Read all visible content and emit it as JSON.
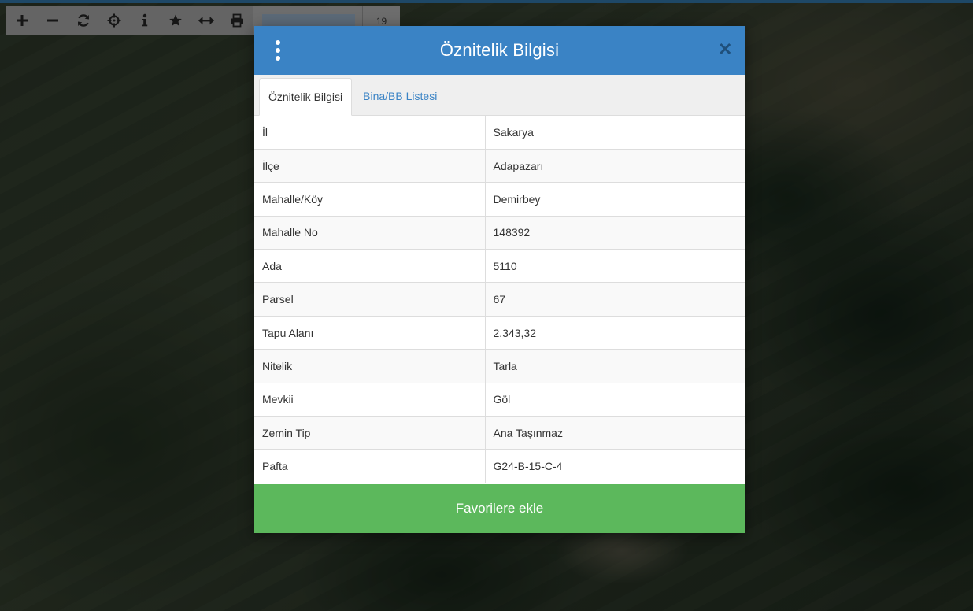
{
  "toolbar": {
    "tools": [
      {
        "icon": "zoom-in-icon",
        "glyph": "+"
      },
      {
        "icon": "zoom-out-icon",
        "glyph": "−"
      },
      {
        "icon": "refresh-icon",
        "glyph": "⟳"
      },
      {
        "icon": "locate-icon",
        "glyph": "⌖"
      },
      {
        "icon": "info-icon",
        "glyph": "i"
      },
      {
        "icon": "star-icon",
        "glyph": "★"
      },
      {
        "icon": "measure-icon",
        "glyph": "⟷"
      },
      {
        "icon": "print-icon",
        "glyph": "⎙"
      }
    ],
    "search_value": "",
    "zoom_level": "19"
  },
  "modal": {
    "title": "Öznitelik Bilgisi",
    "tabs": [
      {
        "label": "Öznitelik Bilgisi",
        "active": true
      },
      {
        "label": "Bina/BB Listesi",
        "active": false
      }
    ],
    "rows": [
      {
        "key": "İl",
        "value": "Sakarya"
      },
      {
        "key": "İlçe",
        "value": "Adapazarı"
      },
      {
        "key": "Mahalle/Köy",
        "value": "Demirbey"
      },
      {
        "key": "Mahalle No",
        "value": "148392"
      },
      {
        "key": "Ada",
        "value": "5110"
      },
      {
        "key": "Parsel",
        "value": "67"
      },
      {
        "key": "Tapu Alanı",
        "value": "2.343,32"
      },
      {
        "key": "Nitelik",
        "value": "Tarla"
      },
      {
        "key": "Mevkii",
        "value": "Göl"
      },
      {
        "key": "Zemin Tip",
        "value": "Ana Taşınmaz"
      },
      {
        "key": "Pafta",
        "value": "G24-B-15-C-4"
      }
    ],
    "favorite_label": "Favorilere ekle"
  },
  "colors": {
    "header": "#3a83c5",
    "favorite_button": "#5cb85c",
    "close_icon": "#1f4f7a"
  }
}
